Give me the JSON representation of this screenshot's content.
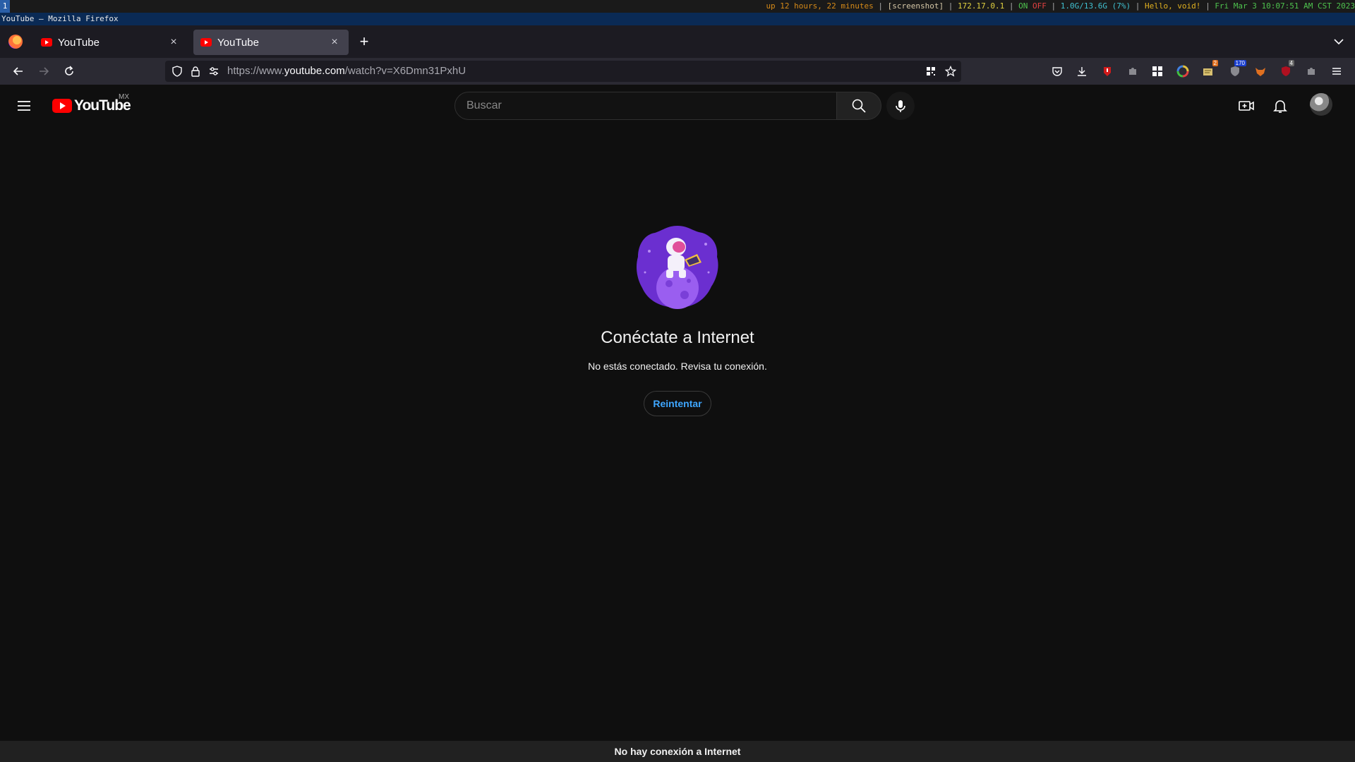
{
  "wm": {
    "workspace": "1",
    "uptime": "up 12 hours, 22 minutes",
    "screenshot": "[screenshot]",
    "ip": "172.17.0.1",
    "on": "ON",
    "off": "OFF",
    "memory": "1.0G/13.6G (7%)",
    "hello": "Hello, void!",
    "datetime": "Fri Mar  3 10:07:51 AM CST 2023",
    "sep": "|"
  },
  "window_title": "YouTube — Mozilla Firefox",
  "tabs": [
    {
      "label": "YouTube",
      "active": false
    },
    {
      "label": "YouTube",
      "active": true
    }
  ],
  "tab_close": "×",
  "new_tab": "+",
  "url": {
    "prefix": "https://www.",
    "domain": "youtube.com",
    "path": "/watch?v=X6Dmn31PxhU"
  },
  "extensions": {
    "badge_a": "2",
    "badge_b": "170",
    "badge_c": "4"
  },
  "youtube": {
    "logo_text": "YouTube",
    "country_code": "MX",
    "search_placeholder": "Buscar"
  },
  "offline": {
    "title": "Conéctate a Internet",
    "subtitle": "No estás conectado. Revisa tu conexión.",
    "retry_label": "Reintentar"
  },
  "banner": "No hay conexión a Internet",
  "colors": {
    "accent_blue": "#3ea6ff",
    "yt_red": "#ff0000",
    "background": "#0f0f0f"
  }
}
